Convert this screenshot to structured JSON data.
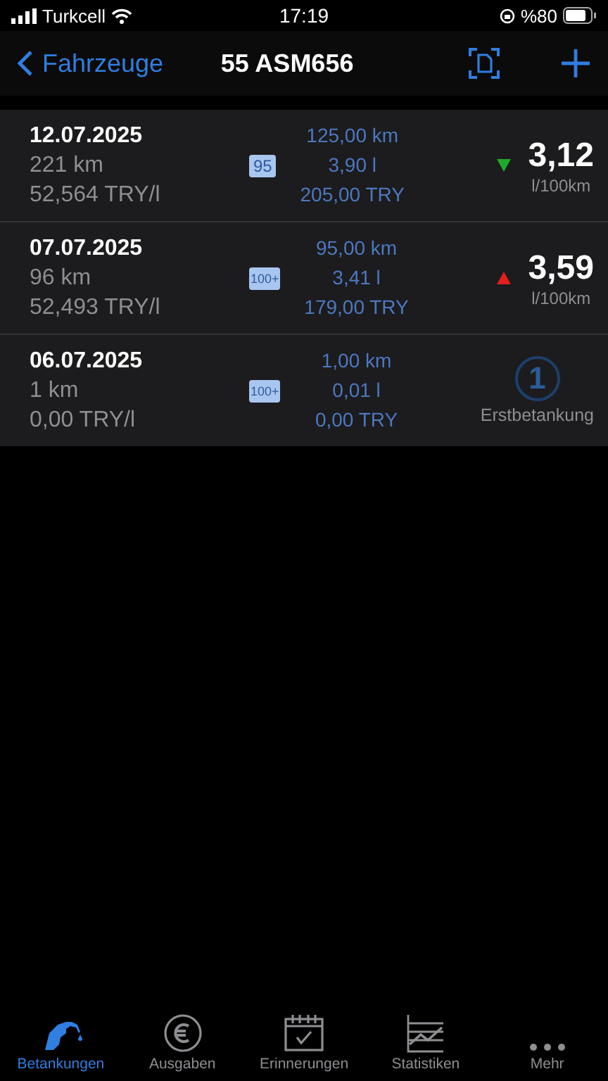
{
  "status_bar": {
    "carrier": "Turkcell",
    "time": "17:19",
    "battery": "%80"
  },
  "nav": {
    "back": "Fahrzeuge",
    "title": "55 ASM656"
  },
  "entries": [
    {
      "date": "12.07.2025",
      "distance": "221 km",
      "price": "52,564 TRY/l",
      "fuel": "95",
      "trip": "125,00 km",
      "volume": "3,90 l",
      "cost": "205,00 TRY",
      "kind": "trend",
      "rising": false,
      "consumption": "3,12",
      "unit": "l/100km"
    },
    {
      "date": "07.07.2025",
      "distance": "96 km",
      "price": "52,493 TRY/l",
      "fuel": "100+",
      "trip": "95,00 km",
      "volume": "3,41 l",
      "cost": "179,00 TRY",
      "kind": "trend",
      "rising": true,
      "consumption": "3,59",
      "unit": "l/100km"
    },
    {
      "date": "06.07.2025",
      "distance": "1 km",
      "price": "0,00 TRY/l",
      "fuel": "100+",
      "trip": "1,00 km",
      "volume": "0,01 l",
      "cost": "0,00 TRY",
      "kind": "first",
      "number": "1",
      "label": "Erstbetankung"
    }
  ],
  "tabs": [
    {
      "label": "Betankungen",
      "kind": "fuel",
      "selected": true
    },
    {
      "label": "Ausgaben",
      "kind": "euro",
      "selected": false
    },
    {
      "label": "Erinnerungen",
      "kind": "calendar",
      "selected": false
    },
    {
      "label": "Statistiken",
      "kind": "chart",
      "selected": false
    },
    {
      "label": "Mehr",
      "kind": "more",
      "selected": false
    }
  ]
}
